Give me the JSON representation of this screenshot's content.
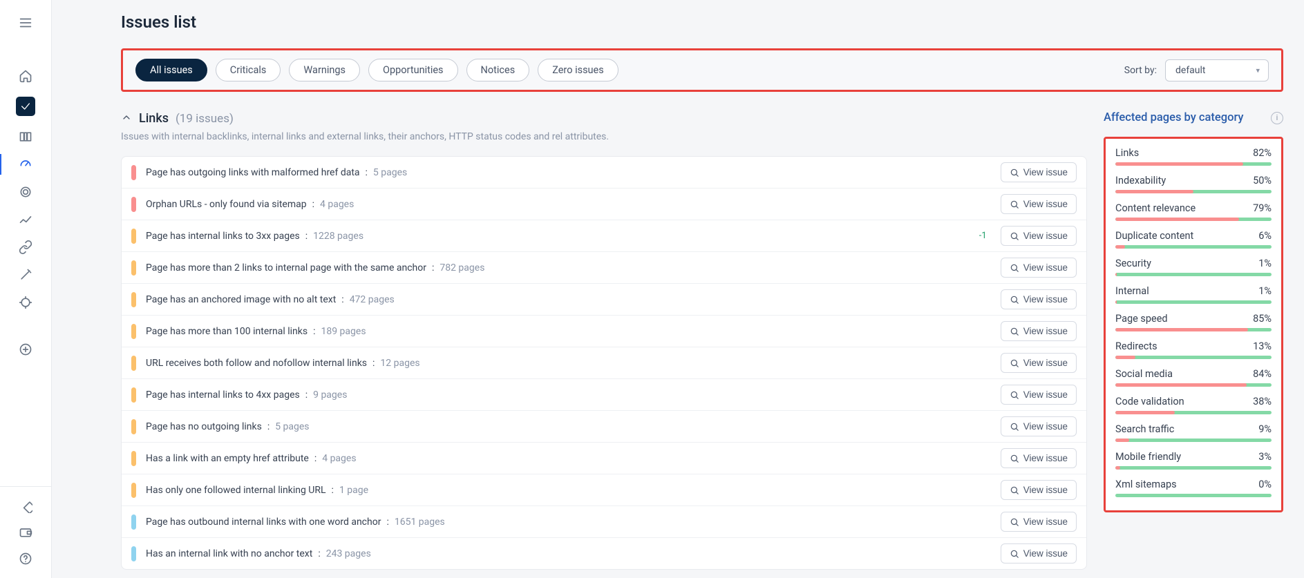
{
  "page": {
    "title": "Issues list"
  },
  "filters": {
    "chips": [
      "All issues",
      "Criticals",
      "Warnings",
      "Opportunities",
      "Notices",
      "Zero issues"
    ],
    "active_index": 0,
    "sort_label": "Sort by:",
    "sort_value": "default"
  },
  "section": {
    "name": "Links",
    "count_text": "(19 issues)",
    "description": "Issues with internal backlinks, internal links and external links, their anchors, HTTP status codes and rel attributes."
  },
  "view_btn_label": "View issue",
  "issues": [
    {
      "sev": "critical",
      "title": "Page has outgoing links with malformed href data",
      "pages": "5 pages"
    },
    {
      "sev": "critical",
      "title": "Orphan URLs - only found via sitemap",
      "pages": "4 pages"
    },
    {
      "sev": "warning",
      "title": "Page has internal links to 3xx pages",
      "pages": "1228 pages",
      "delta": "-1"
    },
    {
      "sev": "warning",
      "title": "Page has more than 2 links to internal page with the same anchor",
      "pages": "782 pages"
    },
    {
      "sev": "warning",
      "title": "Page has an anchored image with no alt text",
      "pages": "472 pages"
    },
    {
      "sev": "warning",
      "title": "Page has more than 100 internal links",
      "pages": "189 pages"
    },
    {
      "sev": "warning",
      "title": "URL receives both follow and nofollow internal links",
      "pages": "12 pages"
    },
    {
      "sev": "warning",
      "title": "Page has internal links to 4xx pages",
      "pages": "9 pages"
    },
    {
      "sev": "warning",
      "title": "Page has no outgoing links",
      "pages": "5 pages"
    },
    {
      "sev": "warning",
      "title": "Has a link with an empty href attribute",
      "pages": "4 pages"
    },
    {
      "sev": "warning",
      "title": "Has only one followed internal linking URL",
      "pages": "1 page"
    },
    {
      "sev": "notice",
      "title": "Page has outbound internal links with one word anchor",
      "pages": "1651 pages"
    },
    {
      "sev": "notice",
      "title": "Has an internal link with no anchor text",
      "pages": "243 pages"
    }
  ],
  "categories": {
    "heading": "Affected pages by category",
    "items": [
      {
        "name": "Links",
        "pct": 82
      },
      {
        "name": "Indexability",
        "pct": 50
      },
      {
        "name": "Content relevance",
        "pct": 79
      },
      {
        "name": "Duplicate content",
        "pct": 6
      },
      {
        "name": "Security",
        "pct": 1
      },
      {
        "name": "Internal",
        "pct": 1
      },
      {
        "name": "Page speed",
        "pct": 85
      },
      {
        "name": "Redirects",
        "pct": 13
      },
      {
        "name": "Social media",
        "pct": 84
      },
      {
        "name": "Code validation",
        "pct": 38
      },
      {
        "name": "Search traffic",
        "pct": 9
      },
      {
        "name": "Mobile friendly",
        "pct": 3
      },
      {
        "name": "Xml sitemaps",
        "pct": 0
      }
    ]
  }
}
